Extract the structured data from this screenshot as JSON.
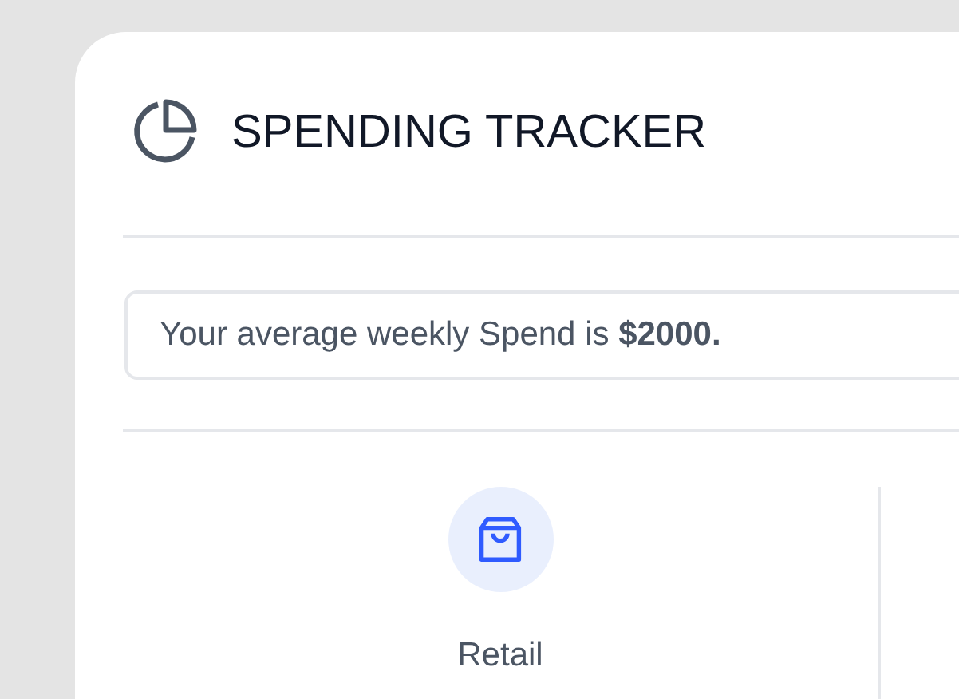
{
  "header": {
    "title": "SPENDING TRACKER"
  },
  "summary": {
    "text": "Your average weekly Spend is **$2000.**"
  },
  "categories": [
    {
      "kind": "retail",
      "label": "Retail"
    }
  ]
}
